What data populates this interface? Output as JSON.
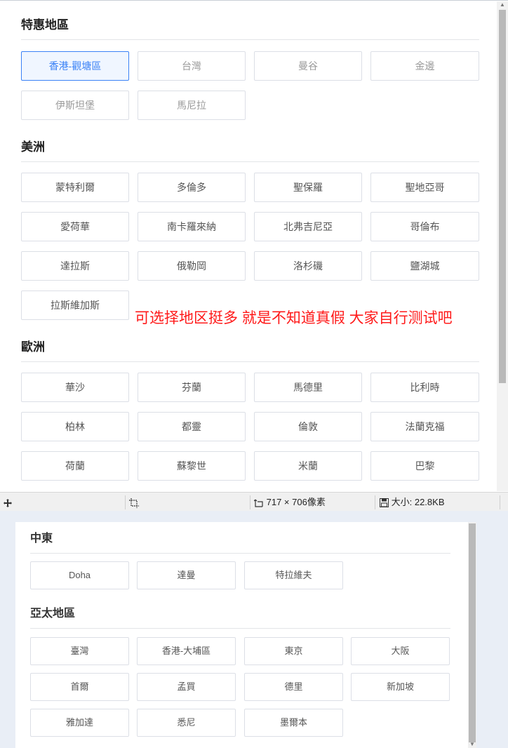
{
  "top": {
    "sections": [
      {
        "title": "特惠地區",
        "items": [
          "香港-觀塘區",
          "台灣",
          "曼谷",
          "金邊",
          "伊斯坦堡",
          "馬尼拉"
        ]
      },
      {
        "title": "美洲",
        "items": [
          "蒙特利爾",
          "多倫多",
          "聖保羅",
          "聖地亞哥",
          "愛荷華",
          "南卡羅來納",
          "北弗吉尼亞",
          "哥倫布",
          "達拉斯",
          "俄勒岡",
          "洛杉磯",
          "鹽湖城",
          "拉斯維加斯"
        ]
      },
      {
        "title": "歐洲",
        "items": [
          "華沙",
          "芬蘭",
          "馬德里",
          "比利時",
          "柏林",
          "都靈",
          "倫敦",
          "法蘭克福",
          "荷蘭",
          "蘇黎世",
          "米蘭",
          "巴黎"
        ]
      }
    ],
    "annotation": "可选择地区挺多 就是不知道真假 大家自行测试吧",
    "status": {
      "dimensions": "717 × 706像素",
      "size": "大小: 22.8KB"
    }
  },
  "bottom": {
    "sections": [
      {
        "title": "中東",
        "items": [
          "Doha",
          "達曼",
          "特拉維夫"
        ]
      },
      {
        "title": "亞太地區",
        "items": [
          "臺灣",
          "香港-大埔區",
          "東京",
          "大阪",
          "首爾",
          "孟買",
          "德里",
          "新加坡",
          "雅加達",
          "悉尼",
          "墨爾本"
        ]
      }
    ]
  },
  "colors": {
    "accent": "#3b82f6",
    "annotation": "#ff1a1a"
  }
}
